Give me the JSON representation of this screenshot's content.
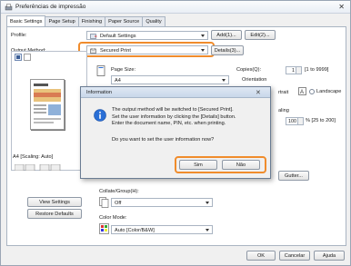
{
  "window": {
    "title": "Preferências de impressão",
    "close_glyph": "✕"
  },
  "tabs": [
    {
      "label": "Basic Settings"
    },
    {
      "label": "Page Setup"
    },
    {
      "label": "Finishing"
    },
    {
      "label": "Paper Source"
    },
    {
      "label": "Quality"
    }
  ],
  "profile": {
    "label": "Profile:",
    "value": "Default Settings",
    "add_button": "Add(1)...",
    "edit_button": "Edit(2)..."
  },
  "output_method": {
    "label": "Output Method:",
    "value": "Secured Print",
    "details_button": "Details(3)..."
  },
  "page_size": {
    "label": "Page Size:",
    "value": "A4"
  },
  "copies": {
    "label": "Copies(Q):",
    "value": "1",
    "range": "[1 to 9999]"
  },
  "orientation": {
    "label": "Orientation",
    "landscape_label": "Landscape",
    "portrait_fragment": "rtrait"
  },
  "scaling": {
    "label_fragment": "aling",
    "value": "100",
    "range": "% [25 to 200]"
  },
  "preview": {
    "caption": "A4 [Scaling: Auto]"
  },
  "gutter_button": "Gutter...",
  "collate": {
    "label": "Collate/Group(H):",
    "value": "Off"
  },
  "color_mode": {
    "label": "Color Mode:",
    "value": "Auto [Color/B&W]"
  },
  "left_buttons": {
    "view_settings": "View Settings",
    "restore_defaults": "Restore Defaults"
  },
  "footer": {
    "ok": "OK",
    "cancel": "Cancelar",
    "help": "Ajuda"
  },
  "dialog": {
    "title": "Information",
    "close_glyph": "✕",
    "line1": "The output method will be switched to [Secured Print].",
    "line2": "Set the user information by clicking the [Details] button.",
    "line3": "Enter the document name, PIN, etc. when printing.",
    "line4": "Do you want to set the user information now?",
    "yes_button": "Sim",
    "no_button": "Não"
  },
  "colors": {
    "highlight": "#f08c2c",
    "info_blue": "#2a6fd6"
  }
}
